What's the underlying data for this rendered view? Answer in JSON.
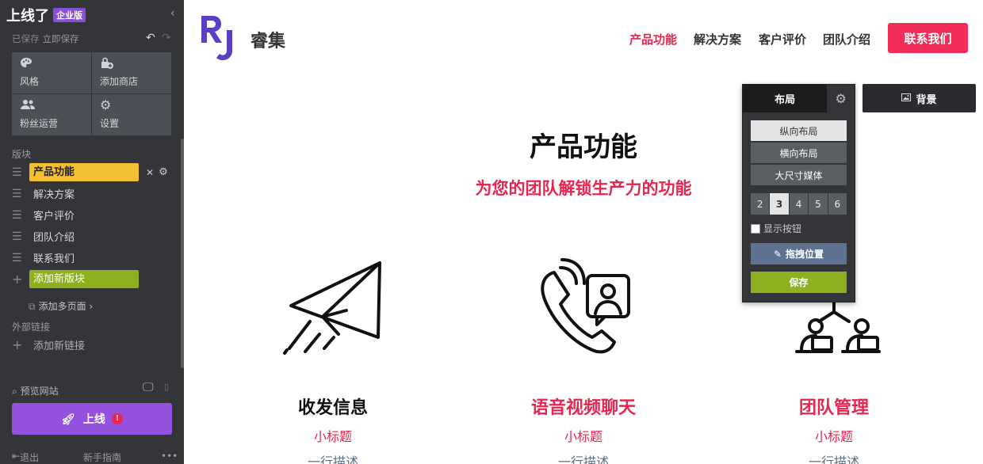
{
  "sidebar": {
    "brand": "上线了",
    "badge": "企业版",
    "collapse_icon": "‹",
    "saved_status": "已保存",
    "save_now": "立即保存",
    "tools": [
      {
        "icon": "palette-icon",
        "glyph": "●",
        "label": "风格"
      },
      {
        "icon": "shop-add-icon",
        "glyph": "▲",
        "label": "添加商店"
      },
      {
        "icon": "fans-icon",
        "glyph": "●●",
        "label": "粉丝运营"
      },
      {
        "icon": "gear-icon",
        "glyph": "⚙",
        "label": "设置"
      }
    ],
    "blocks_label": "版块",
    "blocks": [
      "产品功能",
      "解决方案",
      "客户评价",
      "团队介绍",
      "联系我们"
    ],
    "add_block": "添加新版块",
    "add_pages": "添加多页面 ›",
    "external_links_label": "外部链接",
    "add_link": "添加新链接",
    "preview": "预览网站",
    "publish": "上线",
    "publish_alert": "!",
    "logout": "退出",
    "guide": "新手指南",
    "more": "•••"
  },
  "site": {
    "logo_text": "RJ",
    "name": "睿集",
    "nav": [
      "产品功能",
      "解决方案",
      "客户评价",
      "团队介绍"
    ],
    "contact": "联系我们",
    "section_title": "产品功能",
    "section_subtitle": "为您的团队解锁生产力的功能",
    "features": [
      {
        "title": "收发信息",
        "subtitle": "小标题",
        "desc": "一行描述",
        "icon": "paper-plane-icon",
        "title_color": "#111111"
      },
      {
        "title": "语音视频聊天",
        "subtitle": "小标题",
        "desc": "一行描述",
        "icon": "phone-video-icon",
        "title_color": "#e8254e"
      },
      {
        "title": "团队管理",
        "subtitle": "小标题",
        "desc": "一行描述",
        "icon": "team-icon",
        "title_color": "#e8254e"
      }
    ]
  },
  "layout_panel": {
    "tab": "布局",
    "options": [
      "纵向布局",
      "横向布局",
      "大尺寸媒体"
    ],
    "selected_option": 0,
    "columns": [
      "2",
      "3",
      "4",
      "5",
      "6"
    ],
    "selected_column": 1,
    "show_button": "显示按钮",
    "drag_position": "拖拽位置",
    "save": "保存"
  },
  "background_button": "背景",
  "colors": {
    "accent": "#e8254e",
    "logo_purple": "#5b3fc4",
    "publish_purple": "#9351dd",
    "green": "#8db01e",
    "block_yellow": "#f4c033"
  }
}
